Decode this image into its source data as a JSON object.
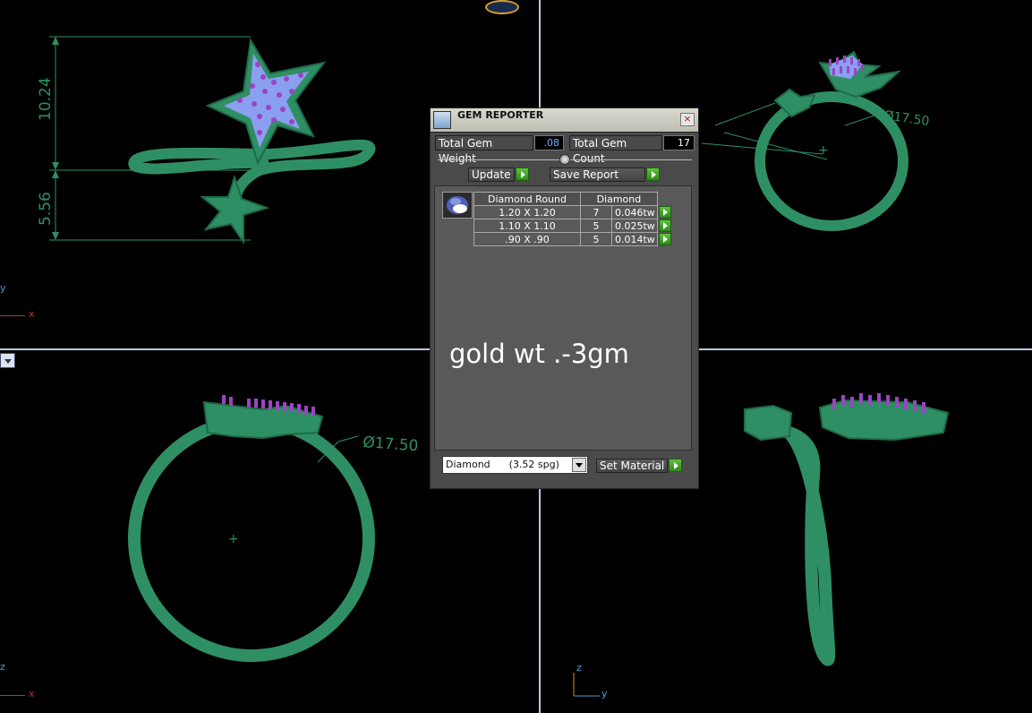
{
  "viewports": {
    "front": {
      "dim_height_top": "10.24",
      "dim_height_bottom": "5.56",
      "axis_up": "y",
      "axis_right": "x"
    },
    "perspective": {
      "dim_diameter": "Ø17.50"
    },
    "top": {
      "dim_diameter": "Ø17.50",
      "axis_up": "z",
      "axis_right": "x"
    },
    "side": {
      "axis_up": "z",
      "axis_right": "y"
    }
  },
  "gem_reporter": {
    "title": "GEM REPORTER",
    "close_label": "×",
    "total_weight_label": "Total Gem Weight",
    "total_weight_value": ".08",
    "total_count_label": "Total Gem Count",
    "total_count_value": "17",
    "update_label": "Update",
    "save_report_label": "Save Report",
    "table": {
      "col_shape": "Diamond Round",
      "col_material": "Diamond",
      "rows": [
        {
          "size": "1.20 X 1.20",
          "count": "7",
          "weight": "0.046tw"
        },
        {
          "size": "1.10 X 1.10",
          "count": "5",
          "weight": "0.025tw"
        },
        {
          "size": ".90 X .90",
          "count": "5",
          "weight": "0.014tw"
        }
      ]
    },
    "note": "gold wt .-3gm",
    "material_select": "Diamond      (3.52 spg)",
    "set_material_label": "Set Material"
  },
  "colors": {
    "metal": "#2f8f64",
    "gem_pave": "#8a9ff0",
    "prong": "#9a44c4",
    "viewport_divider": "#b8c8d8",
    "panel_bg": "#4a4a4a"
  }
}
